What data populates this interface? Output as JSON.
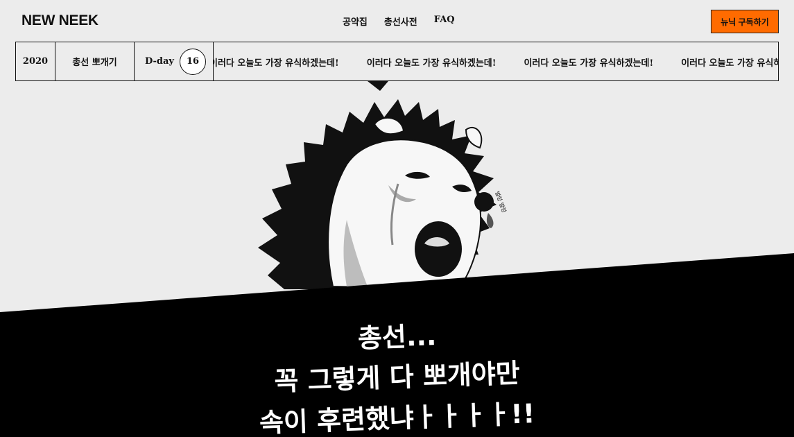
{
  "header": {
    "logo": "NEW NEEK",
    "nav": [
      "공약집",
      "총선사전",
      "FAQ"
    ],
    "subscribe_label": "뉴닉 구독하기"
  },
  "strip": {
    "year": "2020",
    "title": "총선 뽀개기",
    "dday_label": "D-day",
    "dday_number": "16",
    "ticker": [
      "이러다 오늘도 가장 유식하겠는데!",
      "이러다 오늘도 가장 유식하겠는데!",
      "이러다 오늘도 가장 유식하겠는데!",
      "이러다 오늘도 가장 유식하겠는데!"
    ]
  },
  "hero": {
    "line1": "총선...",
    "line2": "꼭 그렇게 다 뽀개야만",
    "line3": "속이 후련했냐ㅏㅏㅏㅏ!!",
    "sound_text": "벌렁 벌렁"
  },
  "colors": {
    "background": "#ececec",
    "accent": "#ff6b00",
    "banner": "#000000",
    "text": "#111111"
  }
}
